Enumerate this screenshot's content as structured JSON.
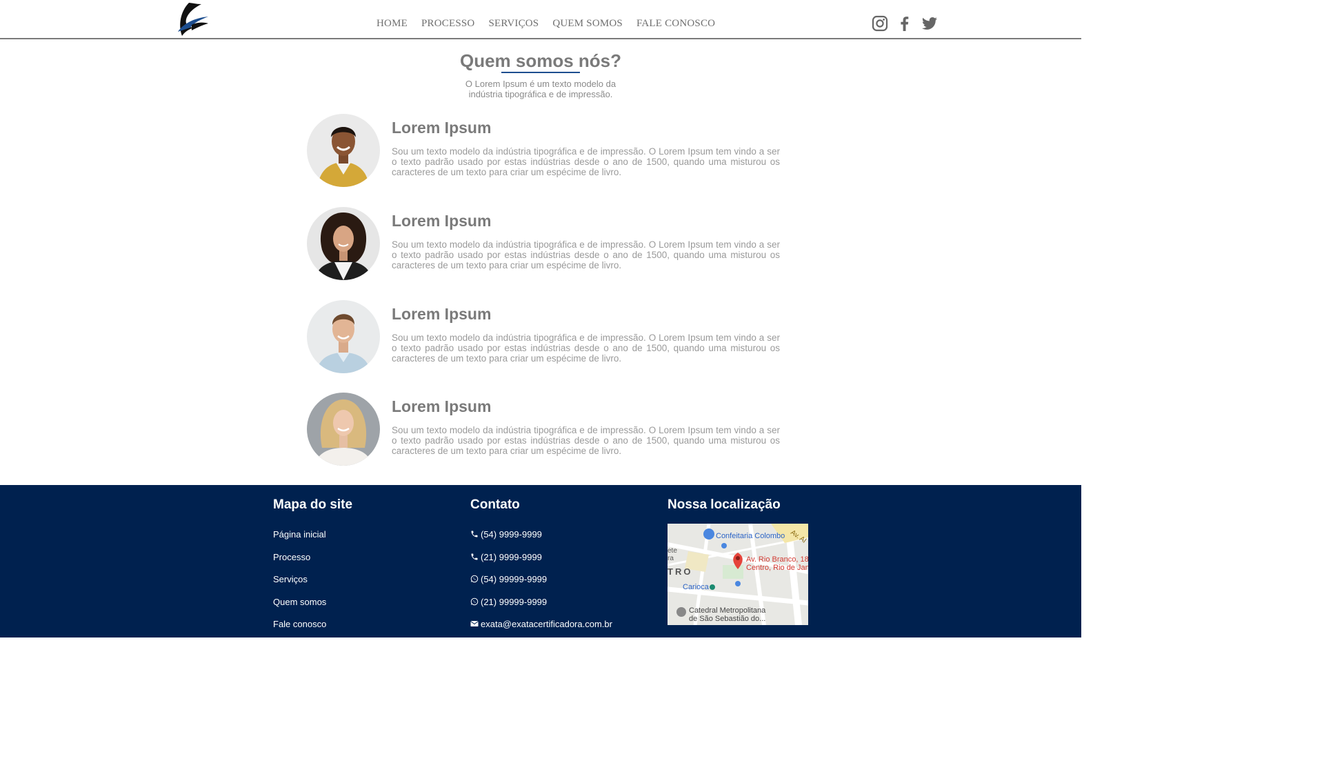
{
  "nav": {
    "items": [
      "HOME",
      "PROCESSO",
      "SERVIÇOS",
      "QUEM SOMOS",
      "FALE CONOSCO"
    ]
  },
  "social": [
    "instagram-icon",
    "facebook-icon",
    "twitter-icon"
  ],
  "main": {
    "title": "Quem somos nós?",
    "subtitle": "O Lorem Ipsum é um texto modelo da indústria tipográfica e de impressão.",
    "members": [
      {
        "name": "Lorem Ipsum",
        "text": "Sou um texto modelo da indústria tipográfica e de impressão. O Lorem Ipsum tem vindo a ser o texto padrão usado por estas indústrias desde o ano de 1500, quando uma misturou os caracteres de um texto para criar um espécime de livro."
      },
      {
        "name": "Lorem Ipsum",
        "text": "Sou um texto modelo da indústria tipográfica e de impressão. O Lorem Ipsum tem vindo a ser o texto padrão usado por estas indústrias desde o ano de 1500, quando uma misturou os caracteres de um texto para criar um espécime de livro."
      },
      {
        "name": "Lorem Ipsum",
        "text": "Sou um texto modelo da indústria tipográfica e de impressão. O Lorem Ipsum tem vindo a ser o texto padrão usado por estas indústrias desde o ano de 1500, quando uma misturou os caracteres de um texto para criar um espécime de livro."
      },
      {
        "name": "Lorem Ipsum",
        "text": "Sou um texto modelo da indústria tipográfica e de impressão. O Lorem Ipsum tem vindo a ser o texto padrão usado por estas indústrias desde o ano de 1500, quando uma misturou os caracteres de um texto para criar um espécime de livro."
      }
    ]
  },
  "footer": {
    "sitemap": {
      "title": "Mapa do site",
      "links": [
        "Página inicial",
        "Processo",
        "Serviços",
        "Quem somos",
        "Fale conosco"
      ]
    },
    "contact": {
      "title": "Contato",
      "items": [
        "(54) 9999-9999",
        "(21) 9999-9999",
        "(54) 99999-9999",
        "(21) 99999-9999",
        "exata@exatacertificadora.com.br"
      ]
    },
    "location": {
      "title": "Nossa localização",
      "map_labels": {
        "poi1": "Confeitaria Colombo",
        "address1": "Av. Rio Branco, 18",
        "address2": "Centro, Rio de Jan",
        "district": "TRO",
        "station": "Carioca",
        "cathedral1": "Catedral Metropolitana",
        "cathedral2": "de São Sebastião do...",
        "edge1": "ete",
        "edge2": "ra",
        "corner": "Av. Al"
      }
    }
  },
  "colors": {
    "accent": "#1d4e8f",
    "footer_bg": "#00214f",
    "text_gray": "#7a7a7a"
  }
}
